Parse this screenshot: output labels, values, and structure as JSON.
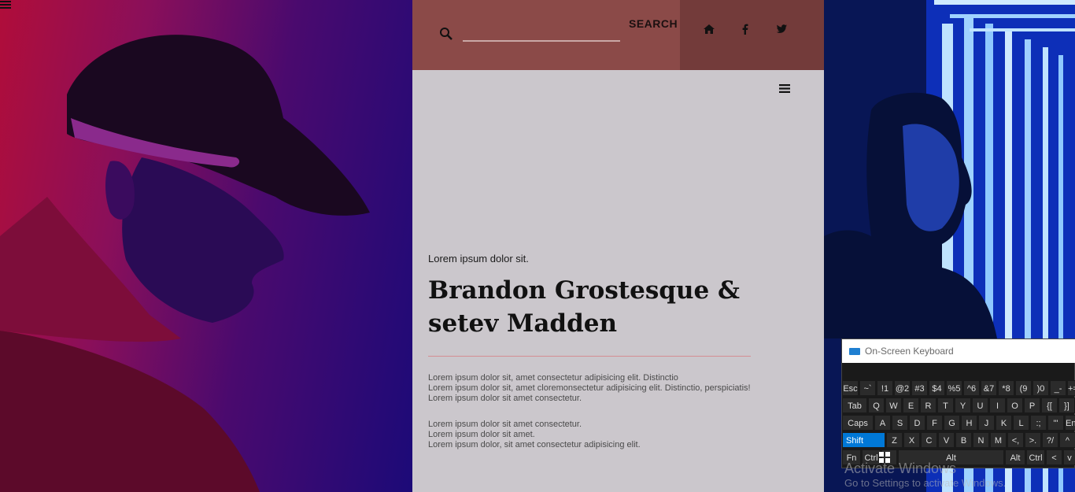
{
  "header": {
    "search_label": "SEARCH",
    "search_placeholder": "",
    "icons": [
      "home-icon",
      "facebook-icon",
      "twitter-icon"
    ]
  },
  "content": {
    "eyebrow": "Lorem ipsum dolor sit.",
    "title": "Brandon Grostesque & setev Madden",
    "paragraph1": [
      "Lorem ipsum dolor sit, amet consectetur adipisicing elit. Distinctio",
      "Lorem ipsum dolor sit, amet cloremonsectetur adipisicing elit. Distinctio, perspiciatis!",
      "Lorem ipsum dolor sit amet consectetur."
    ],
    "paragraph2": [
      "Lorem ipsum dolor sit amet consectetur.",
      "Lorem ipsum dolor sit amet.",
      "Lorem ipsum dolor, sit amet consectetur adipisicing elit."
    ]
  },
  "colors": {
    "topbar": "#8b4a48",
    "social_bar": "#733b3a",
    "content_bg": "#cbc7cc",
    "divider": "#d58e92",
    "keyboard_accent": "#0078d7"
  },
  "osk": {
    "title": "On-Screen Keyboard",
    "rows": [
      [
        "Esc",
        "~`",
        "!1",
        "@2",
        "#3",
        "$4",
        "%5",
        "^6",
        "&7",
        "*8",
        "(9",
        ")0",
        "_-",
        "+="
      ],
      [
        "Tab",
        "Q",
        "W",
        "E",
        "R",
        "T",
        "Y",
        "U",
        "I",
        "O",
        "P",
        "{[",
        "}]"
      ],
      [
        "Caps",
        "A",
        "S",
        "D",
        "F",
        "G",
        "H",
        "J",
        "K",
        "L",
        ":;",
        "\"'",
        "Enter"
      ],
      [
        "Shift",
        "Z",
        "X",
        "C",
        "V",
        "B",
        "N",
        "M",
        "<,",
        ">.",
        "?/",
        "^"
      ],
      [
        "Fn",
        "Ctrl",
        "Win",
        "Alt",
        "Alt",
        "Ctrl",
        "<",
        "v"
      ]
    ]
  },
  "watermark": {
    "line1": "Activate Windows",
    "line2": "Go to Settings to activate Windows."
  }
}
